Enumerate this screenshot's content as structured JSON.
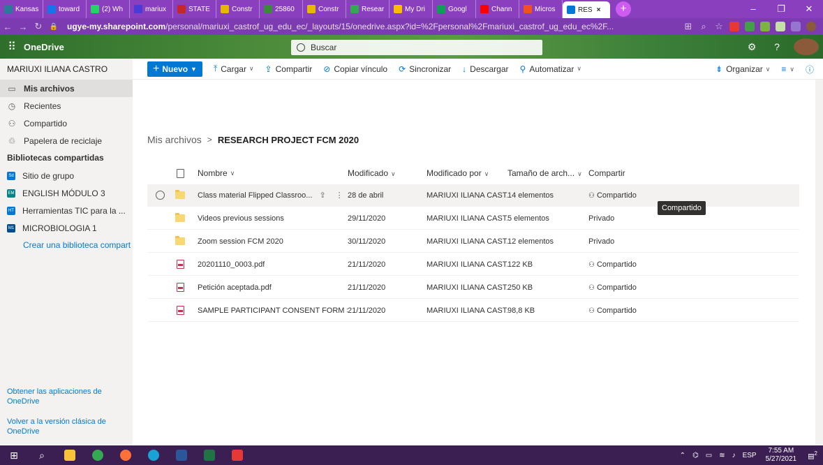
{
  "browser": {
    "tabs": [
      {
        "label": "Kansas",
        "color": "#2b7a9a"
      },
      {
        "label": "toward",
        "color": "#1a73e8"
      },
      {
        "label": "(2) Wh",
        "color": "#25d366"
      },
      {
        "label": "mariux",
        "color": "#4a3ad6"
      },
      {
        "label": "STATE",
        "color": "#c62828"
      },
      {
        "label": "Constr",
        "color": "#e6b800"
      },
      {
        "label": "25860",
        "color": "#3a8a3a"
      },
      {
        "label": "Constr",
        "color": "#e6b800"
      },
      {
        "label": "Resear",
        "color": "#34a853"
      },
      {
        "label": "My Dri",
        "color": "#fbbc05"
      },
      {
        "label": "Googl",
        "color": "#0f9d58"
      },
      {
        "label": "Chann",
        "color": "#ff0000"
      },
      {
        "label": "Micros",
        "color": "#f25022"
      },
      {
        "label": "RES",
        "color": "#0078d4"
      }
    ],
    "close_tab": "×",
    "new_tab": "+",
    "url_domain": "ugye-my.sharepoint.com",
    "url_path": "/personal/mariuxi_castrof_ug_edu_ec/_layouts/15/onedrive.aspx?id=%2Fpersonal%2Fmariuxi_castrof_ug_edu_ec%2F..."
  },
  "suite": {
    "app_name": "OneDrive",
    "search_placeholder": "Buscar",
    "help": "?"
  },
  "sidebar": {
    "user": "MARIUXI ILIANA CASTRO",
    "items": [
      {
        "label": "Mis archivos",
        "icon": "folder-icon"
      },
      {
        "label": "Recientes",
        "icon": "clock-icon"
      },
      {
        "label": "Compartido",
        "icon": "people-icon"
      },
      {
        "label": "Papelera de reciclaje",
        "icon": "trash-icon"
      }
    ],
    "libraries_header": "Bibliotecas compartidas",
    "libraries": [
      {
        "label": "Sitio de grupo",
        "abbr": "Sd",
        "color": "#0078d4"
      },
      {
        "label": "ENGLISH MÓDULO 3",
        "abbr": "EM",
        "color": "#038387"
      },
      {
        "label": "Herramientas TIC para la ...",
        "abbr": "HT",
        "color": "#0078d4"
      },
      {
        "label": "MICROBIOLOGIA 1",
        "abbr": "M1",
        "color": "#004e8c"
      }
    ],
    "create_library": "Crear una biblioteca compart",
    "get_apps": "Obtener las aplicaciones de OneDrive",
    "classic": "Volver a la versión clásica de OneDrive"
  },
  "commands": {
    "new": "Nuevo",
    "upload": "Cargar",
    "share": "Compartir",
    "copy_link": "Copiar vínculo",
    "sync": "Sincronizar",
    "download": "Descargar",
    "automate": "Automatizar",
    "sort": "Organizar"
  },
  "breadcrumb": {
    "root": "Mis archivos",
    "separator": ">",
    "current": "RESEARCH PROJECT FCM 2020"
  },
  "columns": {
    "name": "Nombre",
    "modified": "Modificado",
    "modified_by": "Modificado por",
    "size": "Tamaño de arch...",
    "sharing": "Compartir"
  },
  "rows": [
    {
      "type": "folder",
      "name": "Class material Flipped Classroo...",
      "modified": "28 de abril",
      "by": "MARIUXI ILIANA CAST...",
      "size": "14 elementos",
      "sharing": "Compartido"
    },
    {
      "type": "folder",
      "name": "Videos previous sessions",
      "modified": "29/11/2020",
      "by": "MARIUXI ILIANA CAST...",
      "size": "5 elementos",
      "sharing": "Privado"
    },
    {
      "type": "folder",
      "name": "Zoom session FCM 2020",
      "modified": "30/11/2020",
      "by": "MARIUXI ILIANA CAST...",
      "size": "12 elementos",
      "sharing": "Privado"
    },
    {
      "type": "pdf",
      "name": "20201110_0003.pdf",
      "modified": "21/11/2020",
      "by": "MARIUXI ILIANA CAST...",
      "size": "122 KB",
      "sharing": "Compartido"
    },
    {
      "type": "pdf",
      "name": "Petición aceptada.pdf",
      "modified": "21/11/2020",
      "by": "MARIUXI ILIANA CAST...",
      "size": "250 KB",
      "sharing": "Compartido"
    },
    {
      "type": "pdf",
      "name": "SAMPLE PARTICIPANT CONSENT FORM Spa...",
      "modified": "21/11/2020",
      "by": "MARIUXI ILIANA CAST...",
      "size": "98,8 KB",
      "sharing": "Compartido"
    }
  ],
  "tooltip": "Compartido",
  "taskbar": {
    "lang": "ESP",
    "time": "7:55 AM",
    "date": "5/27/2021",
    "notifications": "2"
  }
}
